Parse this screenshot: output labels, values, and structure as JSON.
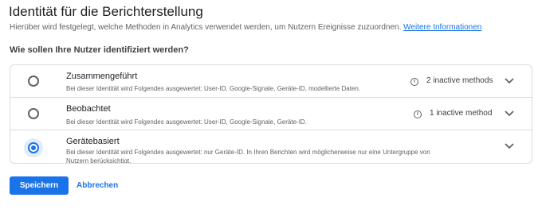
{
  "page": {
    "title": "Identität für die Berichterstellung",
    "description": "Hierüber wird festgelegt, welche Methoden in Analytics verwendet werden, um Nutzern Ereignisse zuzuordnen.",
    "more_info_link": "Weitere Informationen",
    "question": "Wie sollen Ihre Nutzer identifiziert werden?"
  },
  "options": [
    {
      "title": "Zusammengeführt",
      "description": "Bei dieser Identität wird Folgendes ausgewertet: User-ID, Google-Signale, Geräte-ID, modellierte Daten.",
      "inactive": "2 inactive methods",
      "selected": false,
      "info_icon": "info-icon",
      "expand_icon": "chevron-down-icon"
    },
    {
      "title": "Beobachtet",
      "description": "Bei dieser Identität wird Folgendes ausgewertet: User-ID, Google-Signale, Geräte-ID.",
      "inactive": "1 inactive method",
      "selected": false,
      "info_icon": "info-icon",
      "expand_icon": "chevron-down-icon"
    },
    {
      "title": "Gerätebasiert",
      "description": "Bei dieser Identität wird Folgendes ausgewertet: nur Geräte-ID. In Ihren Berichten wird möglicherweise nur eine Untergruppe von Nutzern berücksichtigt.",
      "selected": true,
      "expand_icon": "chevron-down-icon"
    }
  ],
  "actions": {
    "save_label": "Speichern",
    "cancel_label": "Abbrechen"
  },
  "colors": {
    "accent": "#1a73e8",
    "border": "#dadce0",
    "text_secondary": "#5f6368"
  }
}
